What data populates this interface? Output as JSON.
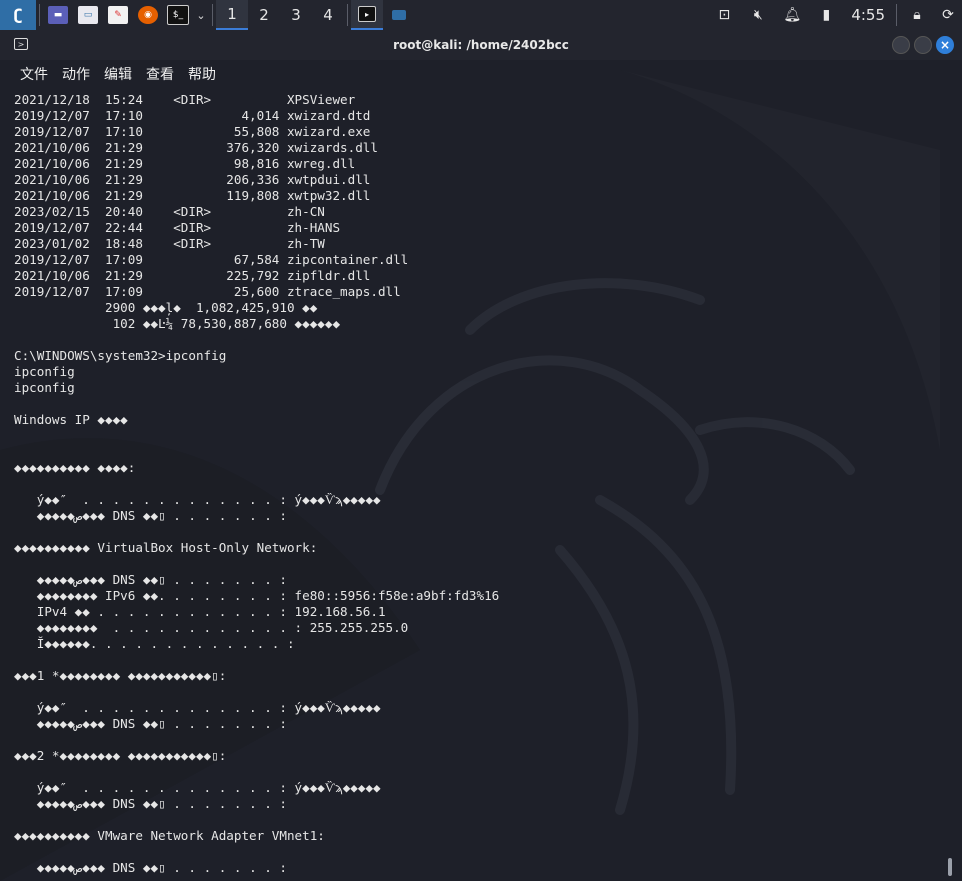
{
  "taskbar": {
    "workspaces": [
      "1",
      "2",
      "3",
      "4"
    ],
    "active_workspace": 0,
    "clock": "4:55",
    "apps": [
      {
        "name": "kali-menu-icon",
        "glyph": "⚔"
      },
      {
        "name": "desktop-icon",
        "glyph": "▬"
      },
      {
        "name": "file-manager-icon",
        "glyph": "▭"
      },
      {
        "name": "text-editor-icon",
        "glyph": "✎"
      },
      {
        "name": "firefox-icon",
        "glyph": "◉"
      },
      {
        "name": "terminal-icon",
        "glyph": "$_"
      }
    ]
  },
  "window": {
    "title": "root@kali: /home/2402bcc"
  },
  "menu": {
    "items": [
      "文件",
      "动作",
      "编辑",
      "查看",
      "帮助"
    ]
  },
  "terminal": {
    "lines": [
      "2021/12/18  15:24    <DIR>          XPSViewer",
      "2019/12/07  17:10             4,014 xwizard.dtd",
      "2019/12/07  17:10            55,808 xwizard.exe",
      "2021/10/06  21:29           376,320 xwizards.dll",
      "2021/10/06  21:29            98,816 xwreg.dll",
      "2021/10/06  21:29           206,336 xwtpdui.dll",
      "2021/10/06  21:29           119,808 xwtpw32.dll",
      "2023/02/15  20:40    <DIR>          zh-CN",
      "2019/12/07  22:44    <DIR>          zh-HANS",
      "2023/01/02  18:48    <DIR>          zh-TW",
      "2019/12/07  17:09            67,584 zipcontainer.dll",
      "2021/10/06  21:29           225,792 zipfldr.dll",
      "2019/12/07  17:09            25,600 ztrace_maps.dll",
      "            2900 ◆◆◆ļ◆  1,082,425,910 ◆◆",
      "             102 ◆◆Ŀ¼ 78,530,887,680 ◆◆◆◆◆◆",
      "",
      "C:\\WINDOWS\\system32>ipconfig",
      "ipconfig",
      "ipconfig",
      "",
      "Windows IP ◆◆◆◆",
      "",
      "",
      "◆◆◆◆◆◆◆◆◆◆ ◆◆◆◆:",
      "",
      "   ý◆◆″  . . . . . . . . . . . . . : ý◆◆◆Ѷϡ◆◆◆◆◆",
      "   ◆◆◆◆◆ص◆◆◆ DNS ◆◆▯ . . . . . . . :",
      "",
      "◆◆◆◆◆◆◆◆◆◆ VirtualBox Host-Only Network:",
      "",
      "   ◆◆◆◆◆ص◆◆◆ DNS ◆◆▯ . . . . . . . :",
      "   ◆◆◆◆◆◆◆◆ IPv6 ◆◆. . . . . . . . : fe80::5956:f58e:a9bf:fd3%16",
      "   IPv4 ◆◆ . . . . . . . . . . . . : 192.168.56.1",
      "   ◆◆◆◆◆◆◆◆  . . . . . . . . . . . . : 255.255.255.0",
      "   Ĭ◆◆◆◆◆◆. . . . . . . . . . . . . :",
      "",
      "◆◆◆1 *◆◆◆◆◆◆◆◆ ◆◆◆◆◆◆◆◆◆◆◆▯:",
      "",
      "   ý◆◆″  . . . . . . . . . . . . . : ý◆◆◆Ѷϡ◆◆◆◆◆",
      "   ◆◆◆◆◆ص◆◆◆ DNS ◆◆▯ . . . . . . . :",
      "",
      "◆◆◆2 *◆◆◆◆◆◆◆◆ ◆◆◆◆◆◆◆◆◆◆◆▯:",
      "",
      "   ý◆◆″  . . . . . . . . . . . . . : ý◆◆◆Ѷϡ◆◆◆◆◆",
      "   ◆◆◆◆◆ص◆◆◆ DNS ◆◆▯ . . . . . . . :",
      "",
      "◆◆◆◆◆◆◆◆◆◆ VMware Network Adapter VMnet1:",
      "",
      "   ◆◆◆◆◆ص◆◆◆ DNS ◆◆▯ . . . . . . . :"
    ]
  }
}
